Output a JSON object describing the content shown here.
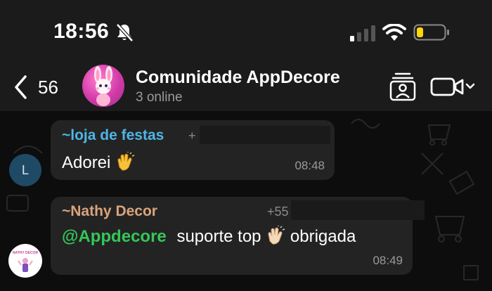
{
  "status_bar": {
    "time": "18:56",
    "icons": [
      "bell-muted-icon",
      "cell-signal-icon",
      "wifi-icon",
      "battery-icon"
    ],
    "battery_level": 0.2,
    "battery_color": "#ffd60a"
  },
  "header": {
    "back_count": "56",
    "group_name": "Comunidade AppDecore",
    "online_text": "3 online",
    "icons": [
      "back-chevron-icon",
      "group-avatar",
      "contact-card-icon",
      "video-call-icon",
      "chevron-down-icon"
    ]
  },
  "messages": [
    {
      "sender": "~loja de festas",
      "phone": "+",
      "text": "Adorei",
      "emoji": "clapping-hands",
      "time": "08:48",
      "sender_color": "#4fb5e8",
      "avatar_letter": "L"
    },
    {
      "sender": "~Nathy Decor",
      "phone": "+55",
      "mention": "@Appdecore",
      "text_after_mention": "suporte top",
      "emoji": "clapping-hands-light",
      "text_end": "obrigada",
      "time": "08:49",
      "sender_color": "#d9a47c"
    }
  ],
  "colors": {
    "mention": "#34c759",
    "bubble": "#232323",
    "header_bg": "#1b1b1b"
  }
}
